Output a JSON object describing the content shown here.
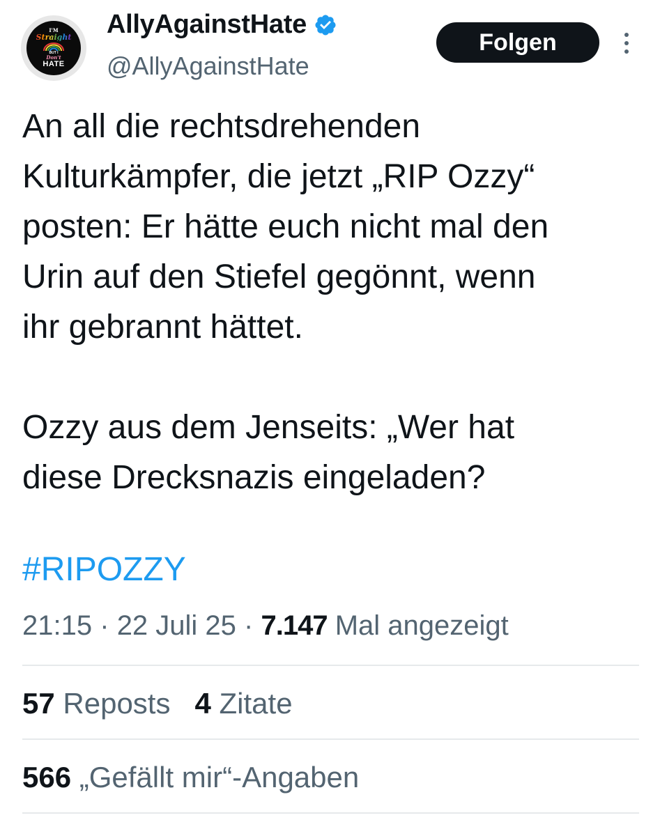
{
  "profile": {
    "avatar_lines": [
      "I'M",
      "Straight",
      "BUT I",
      "Don't",
      "HATE"
    ],
    "display_name": "AllyAgainstHate",
    "handle": "@AllyAgainstHate",
    "verified_icon": "verified-badge-icon",
    "accent_color": "#1d9bf0"
  },
  "actions": {
    "follow_label": "Folgen",
    "more_icon": "more-vertical-icon"
  },
  "tweet": {
    "lines": [
      "An all die rechtsdrehenden",
      "Kulturkämpfer, die jetzt „RIP Ozzy“",
      "posten: Er hätte euch nicht mal den",
      "Urin auf den Stiefel gegönnt, wenn",
      "ihr gebrannt hättet.",
      "",
      "Ozzy aus dem Jenseits: „Wer hat",
      "diese Drecksnazis eingeladen?"
    ],
    "hashtag": "#RIPOZZY"
  },
  "meta": {
    "time": "21:15",
    "date": "22 Juli 25",
    "separator": "·",
    "views_count": "7.147",
    "views_label": "Mal angezeigt"
  },
  "stats": {
    "reposts_count": "57",
    "reposts_label": "Reposts",
    "quotes_count": "4",
    "quotes_label": "Zitate",
    "likes_count": "566",
    "likes_label": "„Gefällt mir“-Angaben"
  }
}
